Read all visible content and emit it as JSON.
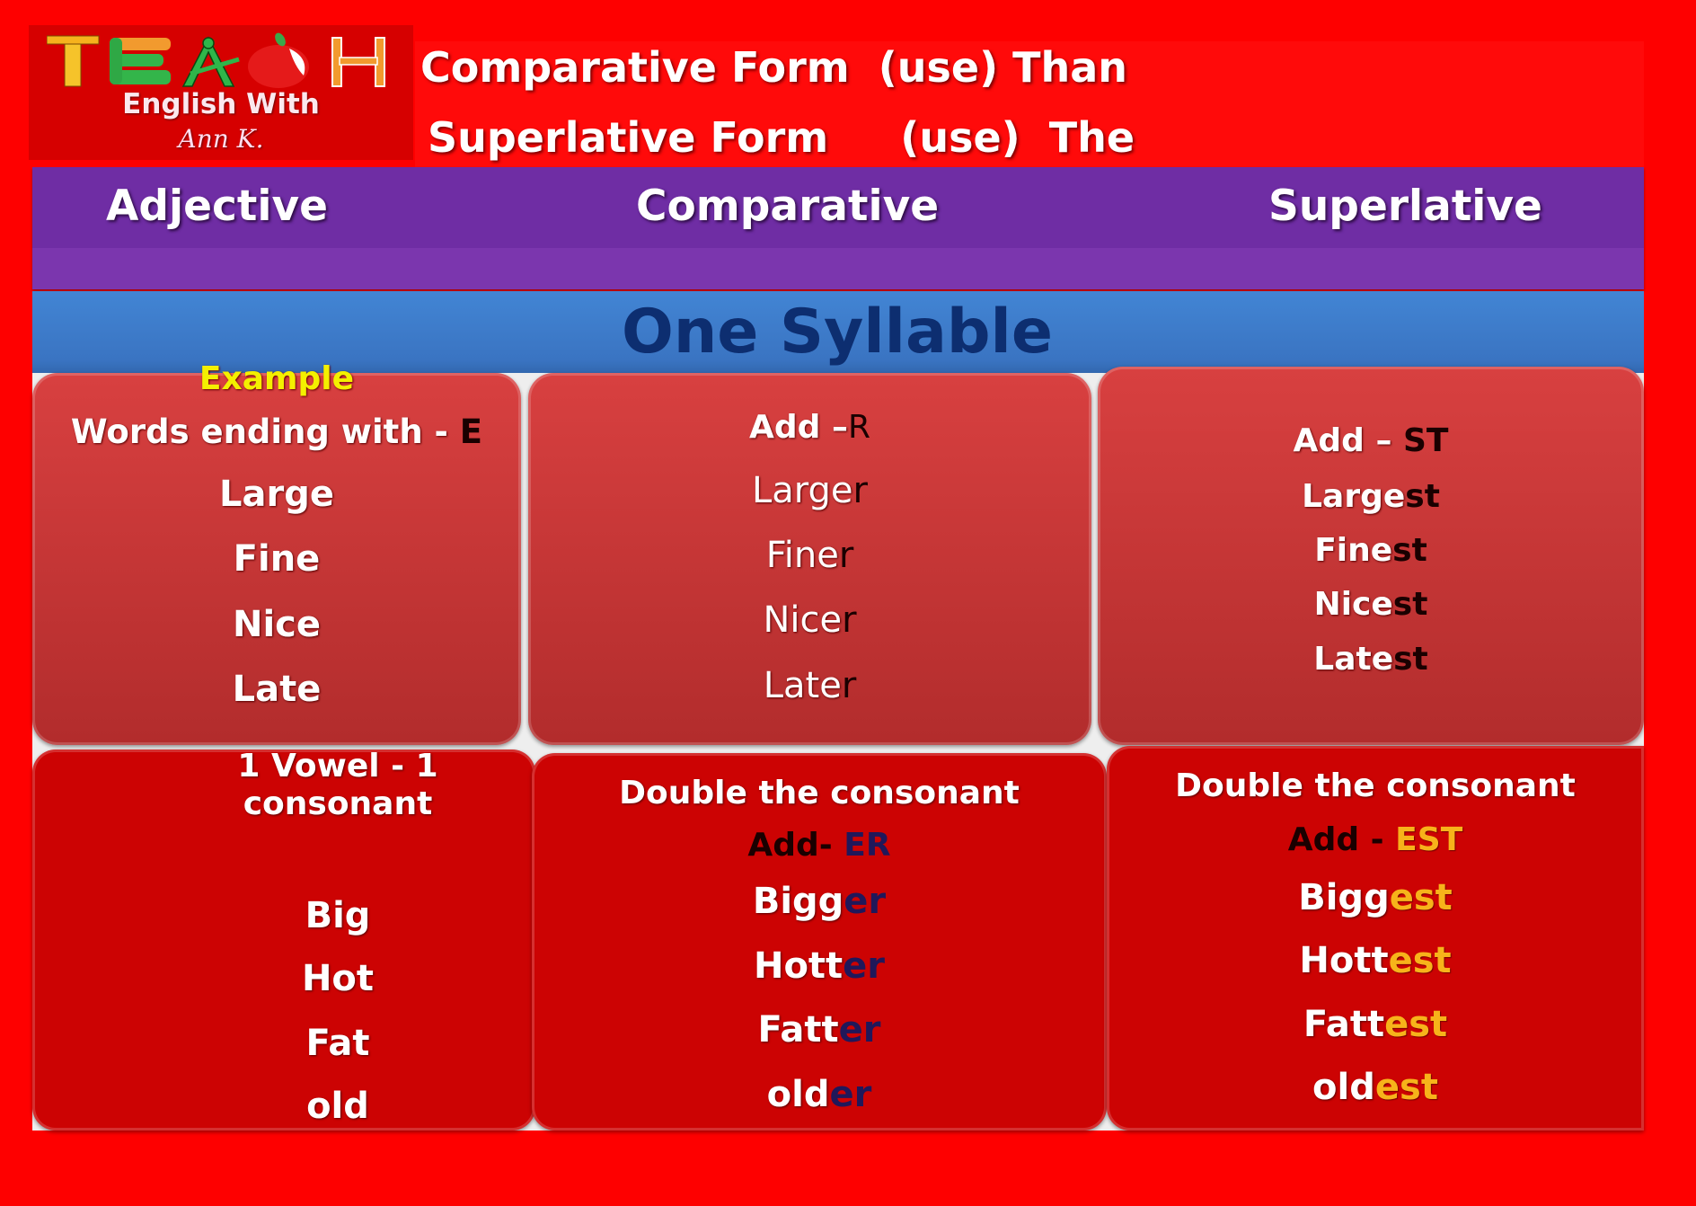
{
  "logo": {
    "wordmark": "TEACH",
    "line1": "English With",
    "line2": "Ann K."
  },
  "title": {
    "line1": "Comparative Form  (use) Than",
    "line2": "Superlative Form     (use)  The"
  },
  "columns": [
    "Adjective",
    "Comparative",
    "Superlative"
  ],
  "section_title": "One Syllable",
  "example_label": "Example",
  "rule1": {
    "adjective": {
      "heading_text": "Words ending with - ",
      "heading_suffix": "E",
      "words": [
        "Large",
        "Fine",
        "Nice",
        "Late"
      ]
    },
    "comparative": {
      "heading_text": "Add –",
      "heading_suffix": "R",
      "words": [
        {
          "stem": "Large",
          "suffix": "r"
        },
        {
          "stem": "Fine",
          "suffix": "r"
        },
        {
          "stem": "Nice",
          "suffix": "r"
        },
        {
          "stem": "Late",
          "suffix": "r"
        }
      ]
    },
    "superlative": {
      "heading_text": "Add – ",
      "heading_suffix": "ST",
      "words": [
        {
          "stem": "Large",
          "suffix": "st"
        },
        {
          "stem": "Fine",
          "suffix": "st"
        },
        {
          "stem": "Nice",
          "suffix": "st"
        },
        {
          "stem": "Late",
          "suffix": "st"
        }
      ]
    }
  },
  "rule2": {
    "adjective": {
      "heading_line1": "1 Vowel - 1",
      "heading_line2": "consonant",
      "words": [
        "Big",
        "Hot",
        "Fat",
        "old"
      ]
    },
    "comparative": {
      "heading": "Double the consonant",
      "add_text": "Add- ",
      "add_suffix": "ER",
      "words": [
        {
          "stem": "Bigg",
          "suffix": "er"
        },
        {
          "stem": "Hott",
          "suffix": "er"
        },
        {
          "stem": "Fatt",
          "suffix": "er"
        },
        {
          "stem": "old",
          "suffix": "er"
        }
      ]
    },
    "superlative": {
      "heading": "Double the consonant",
      "add_text": "Add - ",
      "add_suffix": "EST",
      "words": [
        {
          "stem": "Bigg",
          "suffix": "est"
        },
        {
          "stem": "Hott",
          "suffix": "est"
        },
        {
          "stem": "Fatt",
          "suffix": "est"
        },
        {
          "stem": "old",
          "suffix": "est"
        }
      ]
    }
  },
  "colors": {
    "background": "#fe0000",
    "header_purple": "#6f2da4",
    "band_blue": "#4285d4",
    "section_title": "#0d2e70",
    "example_yellow": "#f4f000",
    "er_suffix_navy": "#20185a",
    "est_suffix_gold": "#f7b31a"
  }
}
